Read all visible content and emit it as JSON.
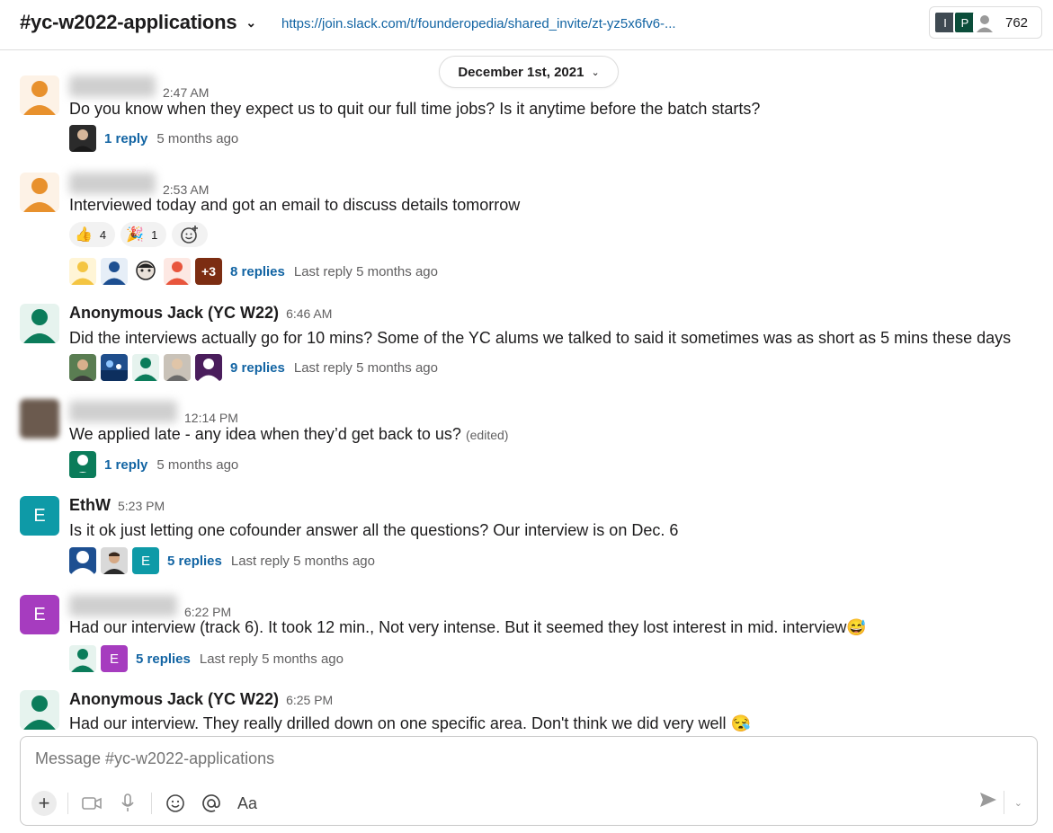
{
  "header": {
    "channel_name": "#yc-w2022-applications",
    "invite_link": "https://join.slack.com/t/founderopedia/shared_invite/zt-yz5x6fv6-...",
    "member_avatar_1": "I",
    "member_avatar_2": "P",
    "member_count": "762"
  },
  "date_divider": "December 1st, 2021",
  "messages": [
    {
      "time": "2:47 AM",
      "text": "Do you know when they expect us to quit our full time jobs? Is it anytime before the batch starts?",
      "thread": {
        "replies": "1 reply",
        "last": "5 months ago"
      }
    },
    {
      "time": "2:53 AM",
      "text": "Interviewed today and got an email to discuss details tomorrow",
      "reactions": [
        {
          "emoji": "👍",
          "count": "4"
        },
        {
          "emoji": "🎉",
          "count": "1"
        }
      ],
      "thread": {
        "more": "+3",
        "replies": "8 replies",
        "last": "Last reply 5 months ago"
      }
    },
    {
      "name": "Anonymous Jack (YC W22)",
      "time": "6:46 AM",
      "text": "Did the interviews actually go for 10 mins? Some of the YC alums we talked to said it sometimes was as short as 5 mins these days",
      "thread": {
        "replies": "9 replies",
        "last": "Last reply 5 months ago"
      }
    },
    {
      "time": "12:14 PM",
      "text": "We applied late - any idea when they’d get back to us?",
      "edited": "(edited)",
      "thread": {
        "replies": "1 reply",
        "last": "5 months ago"
      }
    },
    {
      "name": "EthW",
      "avatar_letter": "E",
      "time": "5:23 PM",
      "text": "Is it ok just letting one cofounder answer all the questions? Our interview is on Dec. 6",
      "thread": {
        "avatar_letter": "E",
        "replies": "5 replies",
        "last": "Last reply 5 months ago"
      }
    },
    {
      "avatar_letter": "E",
      "time": "6:22 PM",
      "text": "Had our interview (track 6). It took 12 min., Not very intense. But it seemed they lost interest in mid. interview",
      "emoji": "😅",
      "thread": {
        "avatar_letter": "E",
        "replies": "5 replies",
        "last": "Last reply 5 months ago"
      }
    },
    {
      "name": "Anonymous Jack (YC W22)",
      "time": "6:25 PM",
      "text": "Had our interview. They really drilled down on one specific area. Don't think we did very well",
      "emoji": "😪"
    }
  ],
  "composer": {
    "placeholder": "Message #yc-w2022-applications",
    "format_label": "Aa"
  },
  "colors": {
    "link": "#1264a3",
    "orange_avatar": "#e8912d",
    "green_avatar": "#0b7c5a",
    "teal_avatar": "#0e9aa7",
    "purple_avatar": "#a63cbf"
  }
}
